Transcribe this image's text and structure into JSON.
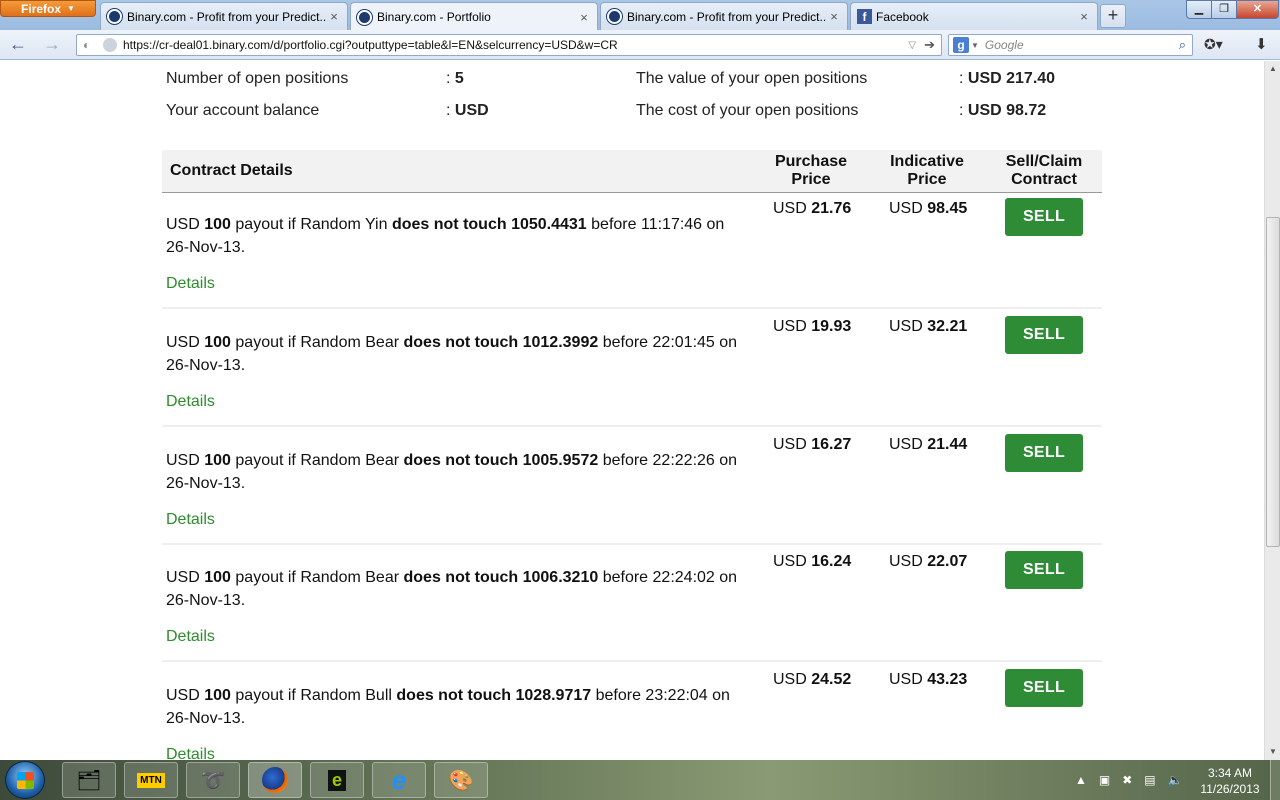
{
  "browser": {
    "menu_label": "Firefox",
    "tabs": [
      {
        "label": "Binary.com - Profit from your Predict...",
        "close": "×"
      },
      {
        "label": "Binary.com - Portfolio",
        "close": "×"
      },
      {
        "label": "Binary.com - Profit from your Predict...",
        "close": "×"
      },
      {
        "label": "Facebook",
        "close": "×"
      }
    ],
    "new_tab": "+",
    "url": "https://cr-deal01.binary.com/d/portfolio.cgi?outputtype=table&l=EN&selcurrency=USD&w=CR",
    "search_placeholder": "Google",
    "search_engine_letter": "g"
  },
  "summary": {
    "open_positions_label": "Number of open positions",
    "open_positions_value": "5",
    "balance_label": "Your account balance",
    "balance_value": "USD",
    "value_label": "The value of your open positions",
    "value_value": "USD 217.40",
    "cost_label": "The cost of your open positions",
    "cost_value": "USD 98.72",
    "separator": ":"
  },
  "table": {
    "header_contract": "Contract Details",
    "header_purchase": [
      "Purchase",
      "Price"
    ],
    "header_indicative": [
      "Indicative",
      "Price"
    ],
    "header_sell": [
      "Sell/Claim",
      "Contract"
    ],
    "currency": "USD",
    "details_label": "Details",
    "sell_label": "SELL",
    "rows": [
      {
        "payout": "100",
        "instrument": "Random Yin",
        "condition": "does not touch",
        "barrier": "1050.4431",
        "time": "11:17:46",
        "date": "26-Nov-13.",
        "purchase": "21.76",
        "indicative": "98.45"
      },
      {
        "payout": "100",
        "instrument": "Random Bear",
        "condition": "does not touch",
        "barrier": "1012.3992",
        "time": "22:01:45",
        "date": "26-Nov-13.",
        "purchase": "19.93",
        "indicative": "32.21"
      },
      {
        "payout": "100",
        "instrument": "Random Bear",
        "condition": "does not touch",
        "barrier": "1005.9572",
        "time": "22:22:26",
        "date": "26-Nov-13.",
        "purchase": "16.27",
        "indicative": "21.44"
      },
      {
        "payout": "100",
        "instrument": "Random Bear",
        "condition": "does not touch",
        "barrier": "1006.3210",
        "time": "22:24:02",
        "date": "26-Nov-13.",
        "purchase": "16.24",
        "indicative": "22.07"
      },
      {
        "payout": "100",
        "instrument": "Random Bull",
        "condition": "does not touch",
        "barrier": "1028.9717",
        "time": "23:22:04",
        "date": "26-Nov-13.",
        "purchase": "24.52",
        "indicative": "43.23"
      }
    ],
    "words": {
      "payout_if": "payout if",
      "before": "before",
      "on": "on"
    }
  },
  "taskbar": {
    "clock_time": "3:34 AM",
    "clock_date": "11/26/2013",
    "items": [
      "file-explorer-icon",
      "mtn-modem-icon",
      "airtel-icon",
      "firefox-icon",
      "etisalat-icon",
      "internet-explorer-icon",
      "paint-icon"
    ]
  }
}
